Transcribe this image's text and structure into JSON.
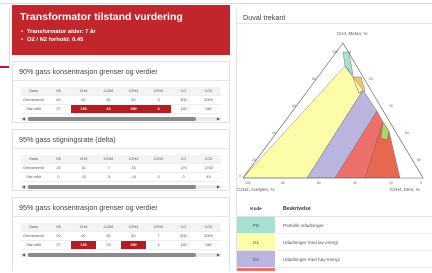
{
  "header": {
    "title": "Transformator tilstand vurdering",
    "bullets": [
      "Transformator alder: 7 år",
      "O2 / N2 forhold: 0.45"
    ],
    "color": "#c0262b"
  },
  "sections": [
    {
      "title": "90% gass konsentrasjon grenser og verdier",
      "columns": [
        "Gass",
        "H2",
        "CH4",
        "C2H6",
        "C2H4",
        "C2H2",
        "CO",
        "CO2"
      ],
      "rows": [
        {
          "cells": [
            "Grenseverdi",
            "60",
            "40",
            "50",
            "80",
            "3",
            "400",
            "5000"
          ],
          "highlight": []
        },
        {
          "cells": [
            "Sist målt",
            "37",
            "130",
            "24",
            "200",
            "4",
            "150",
            "280"
          ],
          "highlight": [
            2,
            3,
            4,
            5
          ]
        }
      ]
    },
    {
      "title": "95% gass stigningsrate (delta)",
      "columns": [
        "Gass",
        "H2",
        "CH4",
        "C2H6",
        "C2H4",
        "C2H2",
        "CO",
        "CO2"
      ],
      "rows": [
        {
          "cells": [
            "Grenseverdi",
            "25",
            "16",
            "7",
            "28",
            "",
            "175",
            "1750"
          ],
          "highlight": []
        },
        {
          "cells": [
            "Sist målt",
            "0",
            "-10",
            "-3",
            "-10",
            "3",
            "0",
            "44"
          ],
          "highlight": []
        }
      ]
    },
    {
      "title": "95% gass konsentrasjon grenser og verdier",
      "columns": [
        "Gass",
        "H2",
        "CH4",
        "C2H6",
        "C2H4",
        "C2H2",
        "CO",
        "CO2"
      ],
      "rows": [
        {
          "cells": [
            "Grenseverdi",
            "90",
            "60",
            "50",
            "80",
            "7",
            "600",
            "5000"
          ],
          "highlight": []
        },
        {
          "cells": [
            "Sist målt",
            "37",
            "130",
            "24",
            "200",
            "4",
            "150",
            "280"
          ],
          "highlight": [
            2,
            4
          ]
        }
      ]
    }
  ],
  "duval": {
    "title": "Duval trekant",
    "label_top": "CH4, Metan, %",
    "label_left": "C2H2, Acetylen, %",
    "label_right": "C2H4, Eten, %",
    "ticks": [
      "0",
      "20",
      "40",
      "60",
      "80",
      "100"
    ],
    "zone_colors": {
      "PD": "#a6e0d2",
      "T1": "#fdfca8",
      "T2": "#f5c36e",
      "T3": "#e8674f",
      "D1": "#fdfca8",
      "D2": "#b9b5df",
      "DT": "#a8d86b",
      "red_zone": "#ec6f6a"
    }
  },
  "legend": {
    "headers": [
      "Kode",
      "Beskrivelse"
    ],
    "rows": [
      {
        "code": "PD",
        "description": "Partielle utladninger",
        "color": "#a6e0d2"
      },
      {
        "code": "D1",
        "description": "Utladninger med lav energi",
        "color": "#fdfca8"
      },
      {
        "code": "D2",
        "description": "Utladninger med høy energi",
        "color": "#b9b5df"
      },
      {
        "code": "T3",
        "description": "",
        "color": "#ec6f6a"
      }
    ]
  }
}
